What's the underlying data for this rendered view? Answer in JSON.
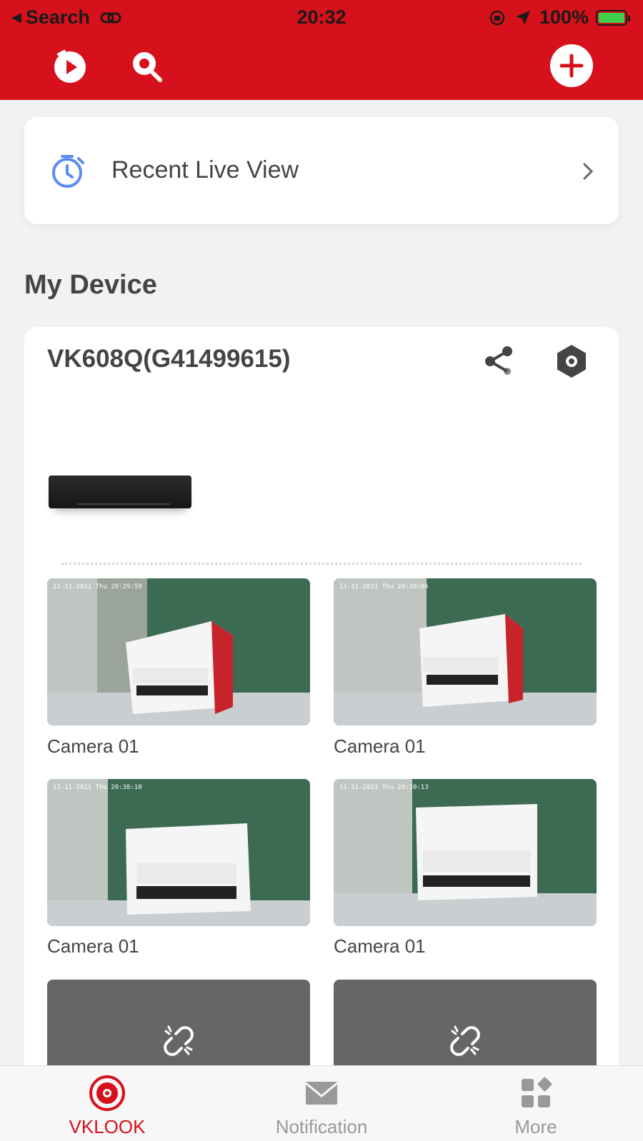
{
  "status_bar": {
    "back_label": "Search",
    "time": "20:32",
    "battery": "100%"
  },
  "header": {
    "icons": [
      "playback-icon",
      "search-icon",
      "add-icon"
    ]
  },
  "recent": {
    "label": "Recent Live View"
  },
  "section": {
    "title": "My Device"
  },
  "device": {
    "name": "VK608Q(G41499615)",
    "cameras": [
      {
        "label": "Camera 01"
      },
      {
        "label": "Camera 01"
      },
      {
        "label": "Camera 01"
      },
      {
        "label": "Camera 01"
      }
    ],
    "offline_icons": [
      "broken-link-icon",
      "broken-link-icon"
    ]
  },
  "tabs": [
    {
      "label": "VKLOOK",
      "active": true
    },
    {
      "label": "Notification",
      "active": false
    },
    {
      "label": "More",
      "active": false
    }
  ],
  "colors": {
    "brand_red": "#d7111b",
    "accent_blue": "#5b8cf0",
    "offline_tile": "#666666"
  }
}
